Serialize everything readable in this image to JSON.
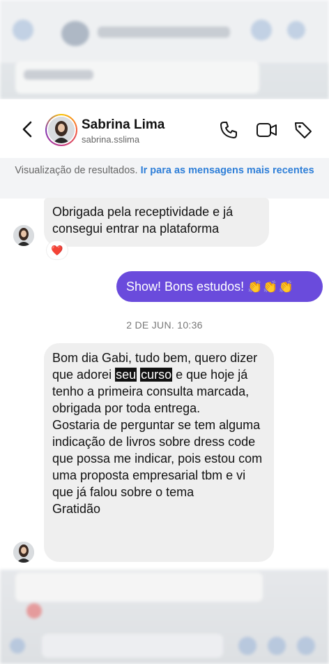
{
  "contact": {
    "name": "Sabrina Lima",
    "handle": "sabrina.sslima"
  },
  "notice": {
    "text": "Visualização de resultados.",
    "link": "Ir para as mensagens mais recentes"
  },
  "messages": [
    {
      "from": "contact",
      "text": "Obrigada pela receptividade  e já consegui entrar na plataforma",
      "reaction": "❤️"
    },
    {
      "from": "me",
      "text": "Show! Bons estudos!",
      "emoji": "👏👏👏"
    }
  ],
  "timestamp": "2 DE JUN. 10:36",
  "long_message": {
    "before": "Bom dia Gabi, tudo bem, quero dizer que adorei ",
    "highlight1": "seu",
    "highlight2": "curso",
    "after": " e que hoje já  tenho a primeira  consulta marcada,  obrigada  por toda entrega.\nGostaria  de perguntar  se tem alguma  indicação  de livros sobre dress code que possa me indicar, pois estou com uma proposta empresarial tbm e vi  que já  falou sobre o tema\nGratidão"
  },
  "colors": {
    "accent": "#6a4bdc",
    "link": "#2f7fd8",
    "bubble": "#efefef",
    "notice_bg": "#f3f4f6"
  },
  "icons": [
    "back-icon",
    "phone-icon",
    "video-icon",
    "tag-icon",
    "heart-reaction-icon"
  ]
}
